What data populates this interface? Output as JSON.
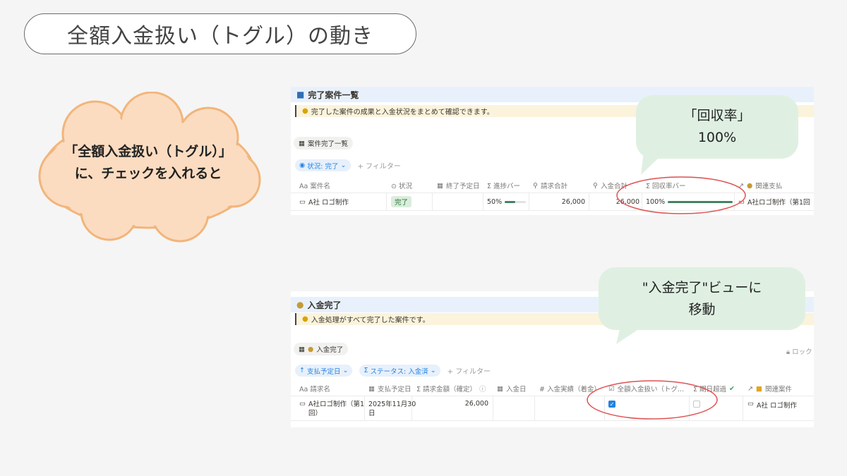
{
  "slide": {
    "title": "全額入金扱い（トグル）の動き"
  },
  "cloud": {
    "line1": "「全額入金扱い（トグル）」",
    "line2": "に、チェックを入れると"
  },
  "bubble1": {
    "line1": "「回収率」",
    "line2": "100%"
  },
  "bubble2": {
    "line1": "\"入金完了\"ビューに",
    "line2": "移動"
  },
  "panel1": {
    "title": "完了案件一覧",
    "callout": "完了した案件の成果と入金状況をまとめて確認できます。",
    "view": "案件完了一覧",
    "filter_chip": "状況: 完了",
    "add_filter": "+ フィルター",
    "headers": {
      "name": "Aa 案件名",
      "status": "⊙ 状況",
      "end_date": "終了予定日",
      "progress": "Σ 進捗バー",
      "invoice_total": "請求合計",
      "received_total": "入金合計",
      "collection_bar": "Σ 回収率バー",
      "related_payment": "関連支払"
    },
    "row": {
      "name": "A社 ロゴ制作",
      "status": "完了",
      "end_date": "",
      "progress_text": "50%",
      "progress": 0.5,
      "invoice_total": "26,000",
      "received_total": "26,000",
      "collection_text": "100%",
      "collection": 1.0,
      "related_payment": "A社ロゴ制作（第1回"
    }
  },
  "panel2": {
    "title": "入金完了",
    "callout": "入金処理がすべて完了した案件です。",
    "view": "入金完了",
    "lock": "ロック",
    "sort_chip": "支払予定日",
    "filter_chip": "ステータス: 入金済",
    "add_filter": "+ フィルター",
    "headers": {
      "invoice_name": "Aa 請求名",
      "due_date": "支払予定日",
      "amount": "Σ 請求金額（確定）",
      "paid_date": "入金日",
      "paid_actual": "# 入金実績（着金）",
      "full_toggle": "全額入金扱い（トグ...",
      "overdue": "Σ 期日超過",
      "related": "関連案件"
    },
    "row": {
      "invoice_name_l1": "A社ロゴ制作（第1",
      "invoice_name_l2": "回）",
      "due_date_l1": "2025年11月30",
      "due_date_l2": "日",
      "amount": "26,000",
      "paid_date": "",
      "paid_actual": "",
      "full_toggle": true,
      "overdue": false,
      "related": "A社 ロゴ制作"
    }
  },
  "colors": {
    "bubble": "#dff0e2",
    "cloud": "#fbdcc1",
    "cloud_stroke": "#f2b57b",
    "highlight": "#e05252"
  }
}
